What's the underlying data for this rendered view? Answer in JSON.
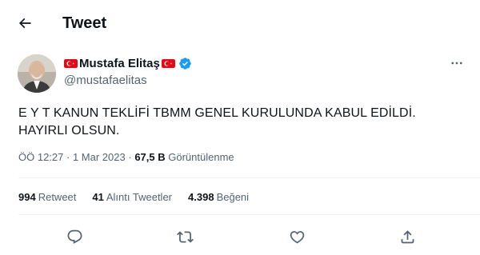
{
  "header": {
    "title": "Tweet"
  },
  "author": {
    "display_name": "Mustafa Elitaş",
    "handle": "@mustafaelitas",
    "verified": true
  },
  "tweet": {
    "lines": [
      "E Y T KANUN TEKLİFİ TBMM GENEL KURULUNDA KABUL EDİLDİ.",
      "HAYIRLI OLSUN."
    ]
  },
  "meta": {
    "time": "ÖÖ 12:27",
    "separator": "·",
    "date": "1 Mar 2023",
    "views_count": "67,5 B",
    "views_label": "Görüntülenme"
  },
  "stats": {
    "retweets": {
      "count": "994",
      "label": "Retweet"
    },
    "quotes": {
      "count": "41",
      "label": "Alıntı Tweetler"
    },
    "likes": {
      "count": "4.398",
      "label": "Beğeni"
    }
  },
  "colors": {
    "text": "#0f1419",
    "secondary": "#536471",
    "verified": "#1d9bf0",
    "flag_red": "#e30a17",
    "divider": "#eff3f4"
  },
  "icons": [
    "back-arrow-icon",
    "turkish-flag-icon",
    "verified-badge-icon",
    "more-icon",
    "reply-icon",
    "retweet-icon",
    "like-icon",
    "share-icon"
  ]
}
